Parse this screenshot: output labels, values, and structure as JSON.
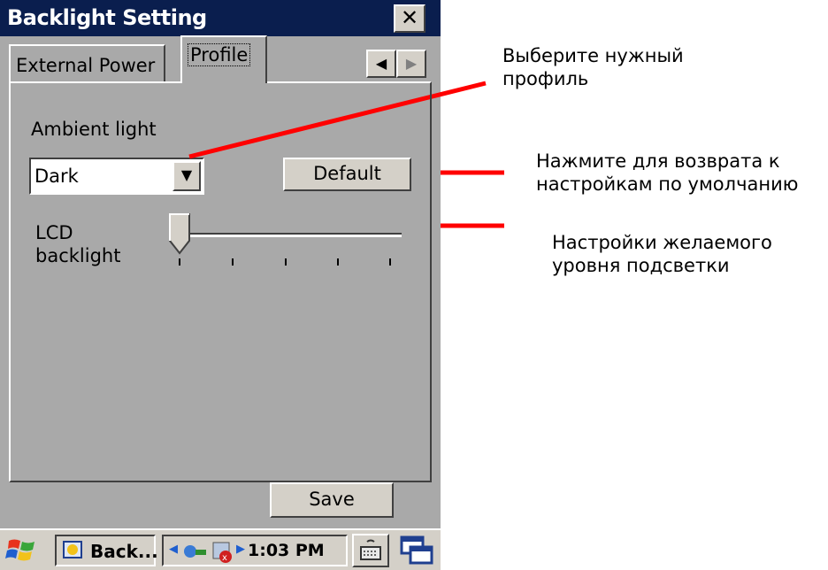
{
  "window": {
    "title": "Backlight Setting",
    "close_icon": "close-icon"
  },
  "tabs": [
    {
      "label": "External Power",
      "selected": false
    },
    {
      "label": "Profile",
      "selected": true
    }
  ],
  "tab_scroll": {
    "left_icon": "arrow-left-icon",
    "right_icon": "arrow-right-icon"
  },
  "profile": {
    "ambient_label": "Ambient light",
    "ambient_value": "Dark",
    "default_button": "Default",
    "lcd_label_line1": "LCD",
    "lcd_label_line2": "backlight",
    "slider": {
      "level_fraction": 0.0,
      "tick_count": 5
    }
  },
  "footer": {
    "save_button": "Save"
  },
  "taskbar": {
    "task_label": "Back...",
    "clock": "1:03 PM",
    "icons": [
      "start-icon",
      "app-icon",
      "network-icon",
      "sync-error-icon",
      "keyboard-icon",
      "switch-window-icon"
    ]
  },
  "annotations": [
    {
      "line1": "Выберите нужный",
      "line2": "профиль"
    },
    {
      "line1": "Нажмите для возврата к",
      "line2": "настройкам по умолчанию"
    },
    {
      "line1": "Настройки желаемого",
      "line2": "уровня подсветки"
    }
  ],
  "colors": {
    "titlebar": "#0a1e4e",
    "window_bg": "#a9a9a9",
    "button_face": "#d4d0c8",
    "annotation_line": "#ff0000"
  }
}
